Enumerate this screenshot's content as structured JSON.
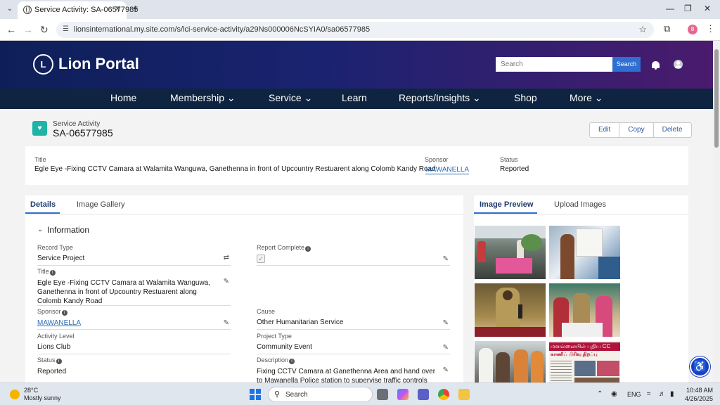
{
  "browser": {
    "tab_title": "Service Activity: SA-06577985",
    "url": "lionsinternational.my.site.com/s/lci-service-activity/a29Ns000006NcSYIA0/sa06577985",
    "profile_initial": "8"
  },
  "header": {
    "logo_mark": "L",
    "logo_text": "Lion Portal",
    "search_placeholder": "Search",
    "search_button": "Search"
  },
  "nav": {
    "items": [
      {
        "label": "Home"
      },
      {
        "label": "Membership ⌄"
      },
      {
        "label": "Service ⌄"
      },
      {
        "label": "Learn"
      },
      {
        "label": "Reports/Insights ⌄"
      },
      {
        "label": "Shop"
      },
      {
        "label": "More ⌄"
      }
    ]
  },
  "record": {
    "type": "Service Activity",
    "name": "SA-06577985",
    "actions": [
      "Edit",
      "Copy",
      "Delete"
    ]
  },
  "highlights": {
    "title_label": "Title",
    "title_value": "Egle Eye -Fixing CCTV Camara at Walamita Wanguwa, Ganethenna in front of Upcountry Restuarent along Colomb Kandy Road",
    "sponsor_label": "Sponsor",
    "sponsor_value": "MAWANELLA",
    "status_label": "Status",
    "status_value": "Reported"
  },
  "details": {
    "tabs": [
      "Details",
      "Image Gallery"
    ],
    "section": "Information",
    "fields": {
      "record_type": {
        "label": "Record Type",
        "value": "Service Project"
      },
      "report_complete": {
        "label": "Report Complete"
      },
      "title": {
        "label": "Title",
        "value": "Egle Eye -Fixing CCTV Camara at Walamita Wanguwa, Ganethenna in front of Upcountry Restuarent along Colomb Kandy Road"
      },
      "sponsor": {
        "label": "Sponsor",
        "value": "MAWANELLA"
      },
      "cause": {
        "label": "Cause",
        "value": "Other Humanitarian Service"
      },
      "activity_level": {
        "label": "Activity Level",
        "value": "Lions Club"
      },
      "project_type": {
        "label": "Project Type",
        "value": "Community Event"
      },
      "status": {
        "label": "Status",
        "value": "Reported"
      },
      "description": {
        "label": "Description",
        "value": "Fixing CCTV Camara at Ganethenna Area and hand over to Mawanella Police station to supervise traffic controls and"
      }
    }
  },
  "images": {
    "tabs": [
      "Image Preview",
      "Upload Images"
    ],
    "newspaper_headline": "மனல்லையில் புதிய CC",
    "newspaper_subhead": "காணிப் பிரிவு திறப்பு"
  },
  "taskbar": {
    "temperature": "28°C",
    "weather": "Mostly sunny",
    "search": "Search",
    "lang": "ENG",
    "time": "10:48 AM",
    "date": "4/26/2025"
  }
}
